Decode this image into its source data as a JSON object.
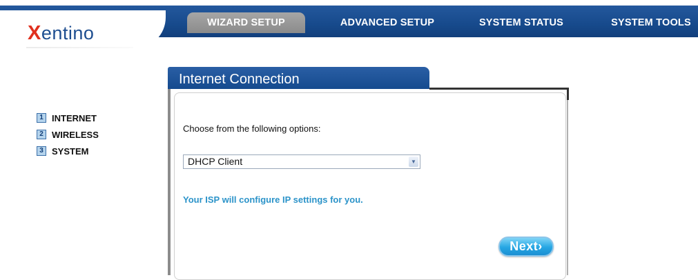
{
  "brand": {
    "logo_x": "X",
    "logo_rest": "entino"
  },
  "nav": {
    "tabs": [
      {
        "label": "WIZARD SETUP",
        "active": true
      },
      {
        "label": "ADVANCED SETUP",
        "active": false
      },
      {
        "label": "SYSTEM STATUS",
        "active": false
      },
      {
        "label": "SYSTEM TOOLS",
        "active": false
      }
    ]
  },
  "steps": [
    {
      "number": "1",
      "label": "INTERNET"
    },
    {
      "number": "2",
      "label": "WIRELESS"
    },
    {
      "number": "3",
      "label": "SYSTEM"
    }
  ],
  "panel": {
    "title": "Internet Connection",
    "prompt": "Choose from the following options:",
    "connection_type": {
      "selected": "DHCP Client"
    },
    "description": "Your ISP will configure IP settings for you.",
    "next_label": "Next",
    "next_icon": "chevron-right-icon"
  },
  "colors": {
    "header_blue": "#174a8c",
    "active_tab_gray": "#9a9a9a",
    "logo_red": "#e0301e",
    "accent_cyan": "#2b93c9",
    "button_blue": "#25a6e3"
  }
}
